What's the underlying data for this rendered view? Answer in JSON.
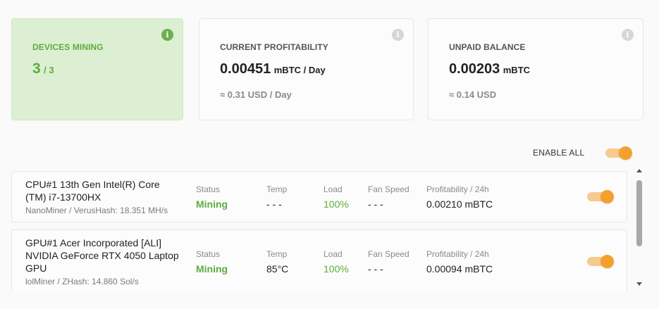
{
  "summary": {
    "devices": {
      "label": "DEVICES MINING",
      "value": "3",
      "total": "/ 3"
    },
    "profitability": {
      "label": "CURRENT PROFITABILITY",
      "value": "0.00451",
      "unit": "mBTC / Day",
      "fiat": "≈ 0.31 USD / Day"
    },
    "balance": {
      "label": "UNPAID BALANCE",
      "value": "0.00203",
      "unit": "mBTC",
      "fiat": "≈ 0.14 USD"
    },
    "info_glyph": "i"
  },
  "enable_all": {
    "label": "ENABLE ALL",
    "on": true
  },
  "columns": {
    "status": "Status",
    "temp": "Temp",
    "load": "Load",
    "fan": "Fan Speed",
    "profit": "Profitability / 24h"
  },
  "devices": [
    {
      "name_line1": "CPU#1 13th Gen Intel(R) Core",
      "name_line2": "(TM) i7-13700HX",
      "name_line3": "",
      "miner": "NanoMiner / VerusHash: 18.351 MH/s",
      "status": "Mining",
      "temp": "- - -",
      "load": "100%",
      "fan": "- - -",
      "profit": "0.00210 mBTC",
      "enabled": true
    },
    {
      "name_line1": "GPU#1 Acer Incorporated [ALI]",
      "name_line2": "NVIDIA GeForce RTX 4050 Laptop",
      "name_line3": "GPU",
      "miner": "lolMiner / ZHash: 14.860 Sol/s",
      "status": "Mining",
      "temp": "85°C",
      "load": "100%",
      "fan": "- - -",
      "profit": "0.00094 mBTC",
      "enabled": true
    }
  ],
  "colors": {
    "accent_green": "#5cad3c",
    "toggle_orange": "#f5a02c",
    "card_green_bg": "#dcefd3"
  }
}
